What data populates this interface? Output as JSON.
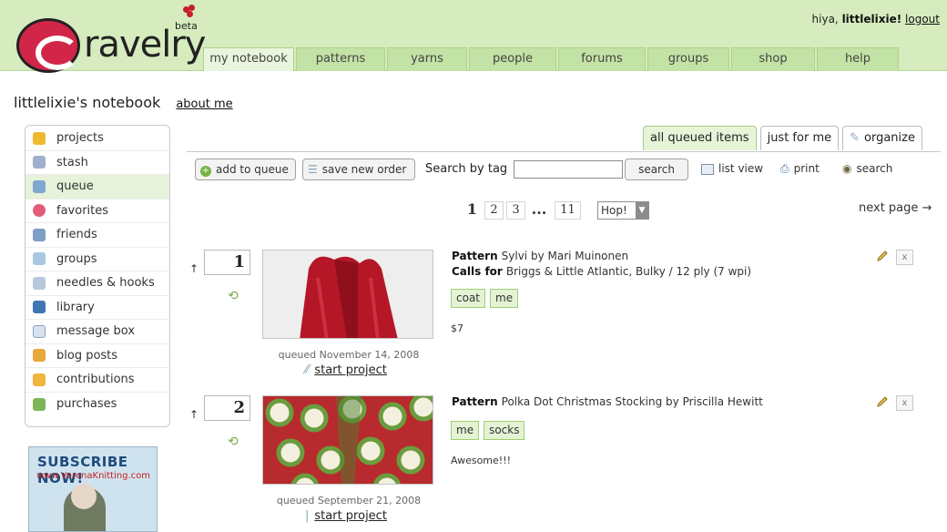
{
  "header": {
    "logo": "ravelry",
    "beta": "beta",
    "greeting": "hiya, ",
    "username": "littlelixie!",
    "logout": "logout"
  },
  "nav": {
    "tabs": [
      "my notebook",
      "patterns",
      "yarns",
      "people",
      "forums",
      "groups",
      "shop",
      "help"
    ],
    "active": "my notebook"
  },
  "page": {
    "title": "littlelixie's notebook",
    "about_link": "about me"
  },
  "sidebar": {
    "items": [
      "projects",
      "stash",
      "queue",
      "favorites",
      "friends",
      "groups",
      "needles & hooks",
      "library",
      "message box",
      "blog posts",
      "contributions",
      "purchases"
    ],
    "active": "queue"
  },
  "ad": {
    "headline": "SUBSCRIBE NOW!",
    "url": "www.VerenaKnitting.com"
  },
  "queue": {
    "view_tabs": [
      "all queued items",
      "just for me",
      "organize"
    ],
    "active_view": "all queued items",
    "toolbar": {
      "add": "add to queue",
      "save_order": "save new order",
      "tag_label": "Search by tag",
      "tag_value": "",
      "search": "search",
      "list_view": "list view",
      "print": "print",
      "search_link": "search"
    },
    "pager": {
      "pages": [
        "1",
        "2",
        "3",
        "11"
      ],
      "current": "1",
      "ellipsis": "...",
      "hop": "Hop!",
      "next": "next page →"
    },
    "labels": {
      "pattern": "Pattern",
      "calls_for": "Calls for"
    },
    "remove_label": "x",
    "entries": [
      {
        "position": "1",
        "pattern": "Sylvi by Mari Muinonen",
        "calls_for": "Briggs & Little Atlantic, Bulky / 12 ply (7 wpi)",
        "tags": [
          "coat",
          "me"
        ],
        "note": "$7",
        "queued": "queued November 14, 2008",
        "start": "start project"
      },
      {
        "position": "2",
        "pattern": "Polka Dot Christmas Stocking by Priscilla Hewitt",
        "tags": [
          "me",
          "socks"
        ],
        "note": "Awesome!!!",
        "queued": "queued September 21, 2008",
        "start": "start project"
      }
    ]
  },
  "colors": {
    "header_bg": "#d6ecbe",
    "tab_bg": "#c3e2a5",
    "tag_bg": "#e4f3d4",
    "logo_red": "#d22649"
  }
}
